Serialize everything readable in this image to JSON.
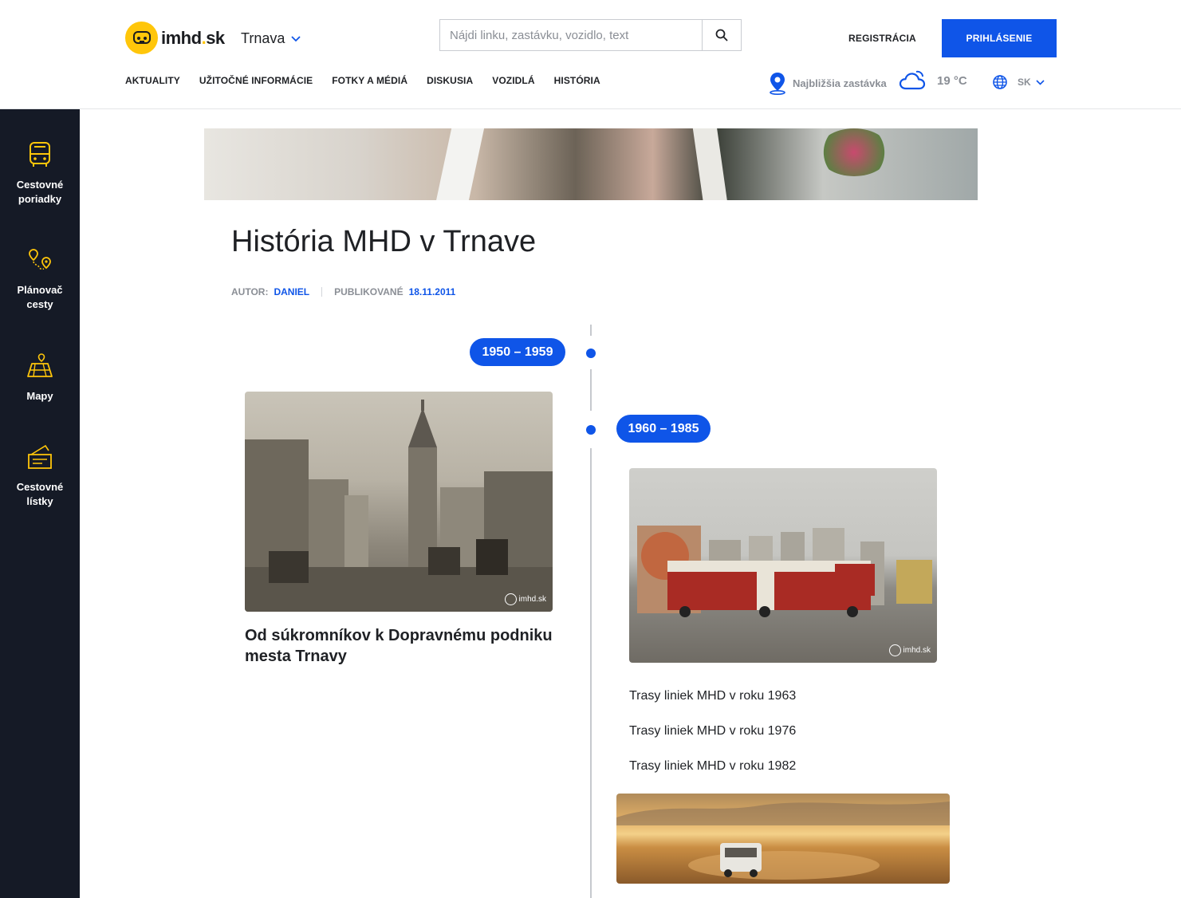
{
  "header": {
    "logo_text": "imhd",
    "logo_dot": ".",
    "logo_tld": "sk",
    "city": "Trnava",
    "search_placeholder": "Nájdi linku, zastávku, vozidlo, text",
    "register_label": "REGISTRÁCIA",
    "login_label": "PRIHLÁSENIE",
    "nav": [
      "AKTUALITY",
      "UŽITOČNÉ INFORMÁCIE",
      "FOTKY A MÉDIÁ",
      "DISKUSIA",
      "VOZIDLÁ",
      "HISTÓRIA"
    ],
    "nearest_stop": "Najbližšia zastávka",
    "temperature": "19 °C",
    "language": "SK",
    "accent_color": "#0f55e8",
    "brand_color": "#ffc60a"
  },
  "sidebar": {
    "items": [
      {
        "label_line1": "Cestovné",
        "label_line2": "poriadky",
        "icon": "bus-icon"
      },
      {
        "label_line1": "Plánovač",
        "label_line2": "cesty",
        "icon": "route-planner-icon"
      },
      {
        "label_line1": "Mapy",
        "label_line2": "",
        "icon": "map-icon"
      },
      {
        "label_line1": "Cestovné",
        "label_line2": "lístky",
        "icon": "ticket-icon"
      }
    ]
  },
  "article": {
    "title": "História MHD v Trnave",
    "author_label": "AUTOR:",
    "author": "DANIEL",
    "published_label": "PUBLIKOVANÉ",
    "published_date": "18.11.2011"
  },
  "timeline": {
    "period1": {
      "label": "1950 – 1959",
      "card_title": "Od súkromníkov k Dopravnému podniku mesta Trnavy",
      "watermark": "imhd.sk"
    },
    "period2": {
      "label": "1960 – 1985",
      "watermark": "imhd.sk",
      "links": [
        "Trasy liniek MHD v roku 1963",
        "Trasy liniek MHD v roku 1976",
        "Trasy liniek MHD v roku 1982"
      ]
    }
  }
}
